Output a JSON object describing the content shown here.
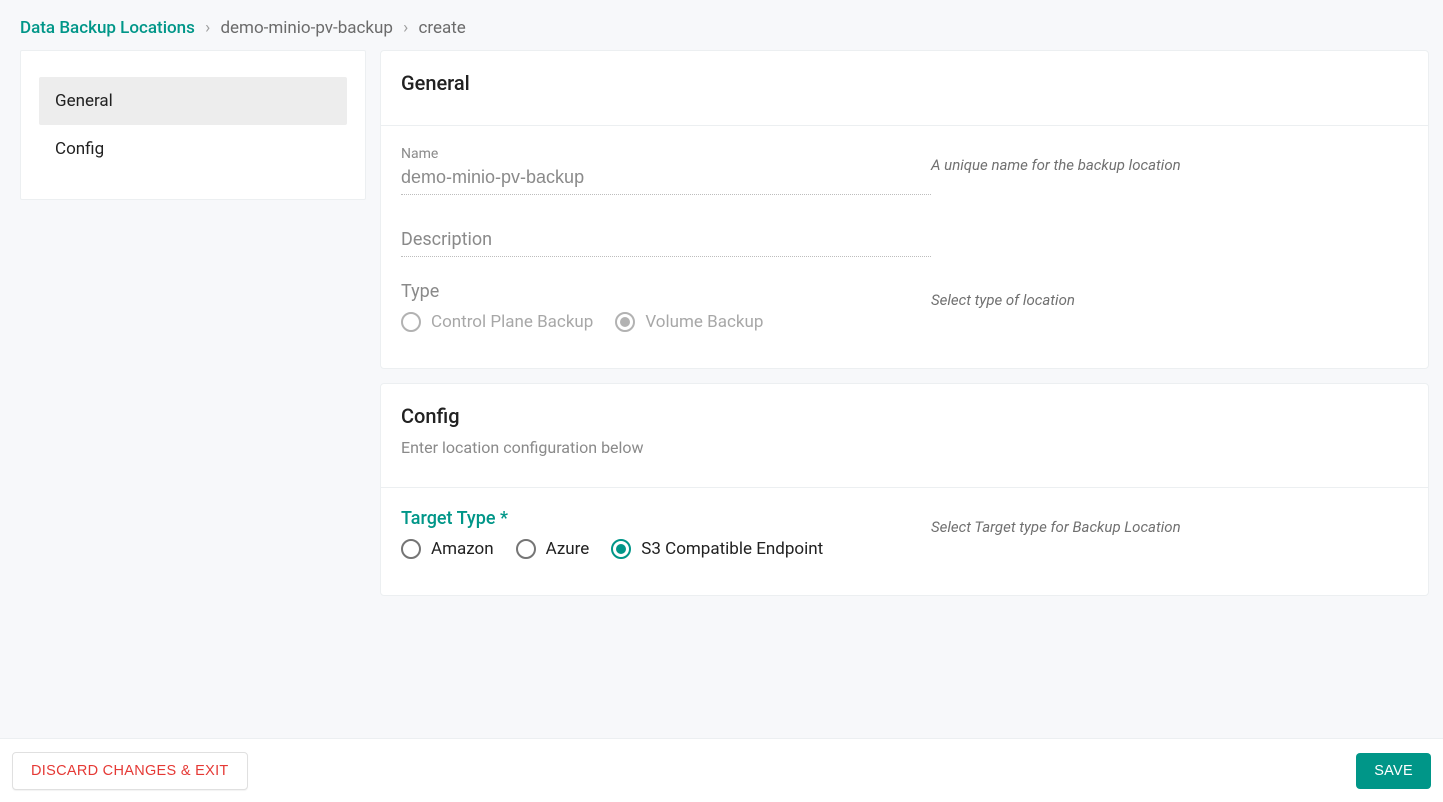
{
  "breadcrumb": {
    "root": "Data Backup Locations",
    "item": "demo-minio-pv-backup",
    "action": "create"
  },
  "sidebar": {
    "items": [
      {
        "label": "General",
        "active": true
      },
      {
        "label": "Config",
        "active": false
      }
    ]
  },
  "general": {
    "title": "General",
    "name_label": "Name",
    "name_value": "demo-minio-pv-backup",
    "name_hint": "A unique name for the backup location",
    "description_label": "Description",
    "description_value": "",
    "type_label": "Type",
    "type_hint": "Select type of location",
    "type_options": {
      "control_plane": "Control Plane Backup",
      "volume": "Volume Backup"
    },
    "type_selected": "volume"
  },
  "config": {
    "title": "Config",
    "subtitle": "Enter location configuration below",
    "target_type_label": "Target Type *",
    "target_type_hint": "Select Target type for Backup Location",
    "target_options": {
      "amazon": "Amazon",
      "azure": "Azure",
      "s3": "S3 Compatible Endpoint"
    },
    "target_selected": "s3"
  },
  "footer": {
    "discard": "DISCARD CHANGES & EXIT",
    "save": "SAVE"
  }
}
